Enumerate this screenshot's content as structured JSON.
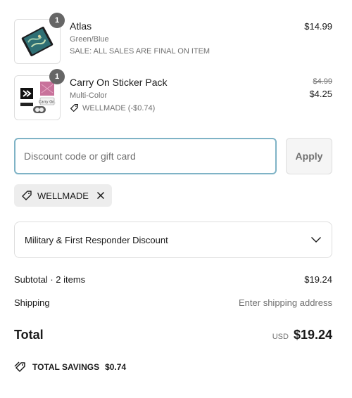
{
  "cart": {
    "items": [
      {
        "name": "Atlas",
        "variant": "Green/Blue",
        "note": "SALE: ALL SALES ARE FINAL ON ITEM",
        "quantity": "1",
        "price": "$14.99",
        "thumb_icon": "book-icon"
      },
      {
        "name": "Carry On Sticker Pack",
        "variant": "Multi-Color",
        "discount_note": "WELLMADE (-$0.74)",
        "quantity": "1",
        "original_price": "$4.99",
        "price": "$4.25",
        "thumb_icon": "sticker-pack-icon"
      }
    ]
  },
  "discount": {
    "placeholder": "Discount code or gift card",
    "apply_label": "Apply",
    "applied_code": "WELLMADE"
  },
  "program": {
    "label": "Military & First Responder Discount"
  },
  "summary": {
    "subtotal_label": "Subtotal · 2 items",
    "subtotal_value": "$19.24",
    "shipping_label": "Shipping",
    "shipping_value": "Enter shipping address",
    "total_label": "Total",
    "currency": "USD",
    "total_value": "$19.24",
    "savings_label": "TOTAL SAVINGS",
    "savings_value": "$0.74"
  },
  "colors": {
    "input_border_focus": "#7fb3c6",
    "badge": "#666666",
    "chip_bg": "#ededed",
    "muted_text": "#707070"
  }
}
